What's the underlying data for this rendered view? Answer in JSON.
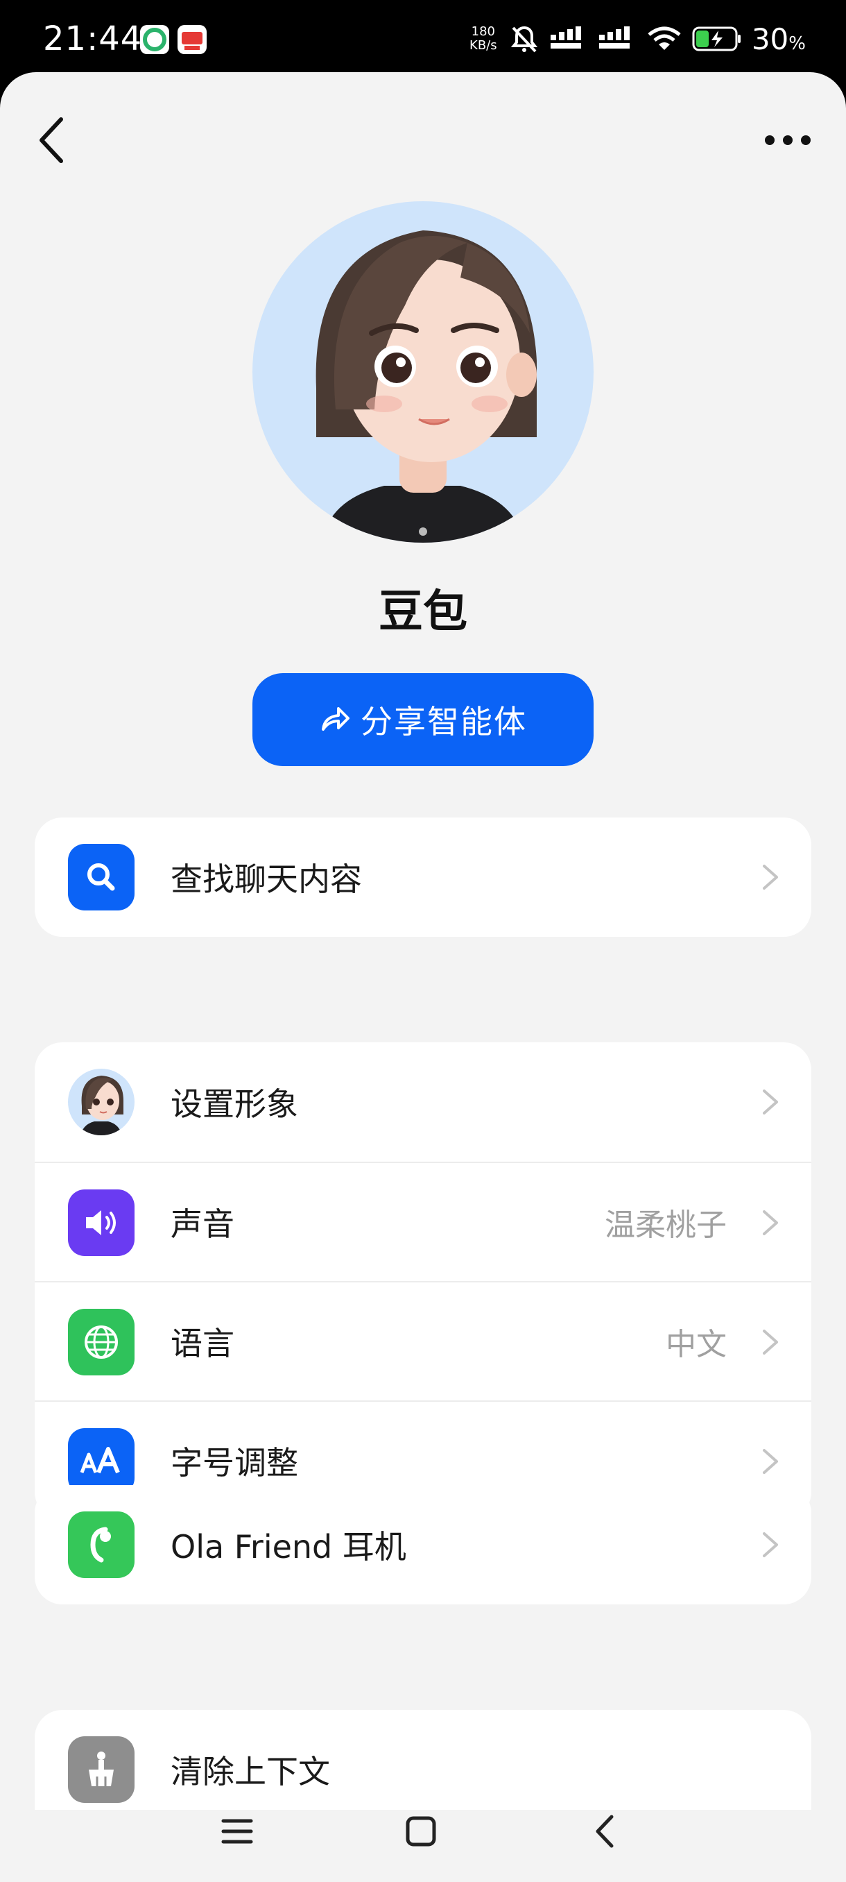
{
  "status_bar": {
    "time": "21:44",
    "net_speed_value": "180",
    "net_speed_unit": "KB/s",
    "battery_percent": "30",
    "battery_symbol": "%"
  },
  "profile": {
    "name": "豆包",
    "share_button_label": "分享智能体",
    "avatar_bg_color": "#cfe4fb"
  },
  "menu": {
    "search": {
      "label": "查找聊天内容",
      "icon": "search-icon",
      "color": "#0b63f6"
    },
    "appearance": {
      "label": "设置形象",
      "icon": "avatar-icon"
    },
    "voice": {
      "label": "声音",
      "value": "温柔桃子",
      "icon": "speaker-icon",
      "color": "#6a3bf2"
    },
    "language": {
      "label": "语言",
      "value": "中文",
      "icon": "globe-icon",
      "color": "#2fc25b"
    },
    "font_size": {
      "label": "字号调整",
      "icon": "font-size-icon",
      "color": "#0b63f6"
    },
    "earphone": {
      "label": "Ola Friend 耳机",
      "icon": "earphone-icon",
      "color": "#35c759"
    },
    "clear_context": {
      "label": "清除上下文",
      "icon": "broom-icon",
      "color": "#8e8e8e"
    }
  },
  "accent_color": "#0b63f6"
}
